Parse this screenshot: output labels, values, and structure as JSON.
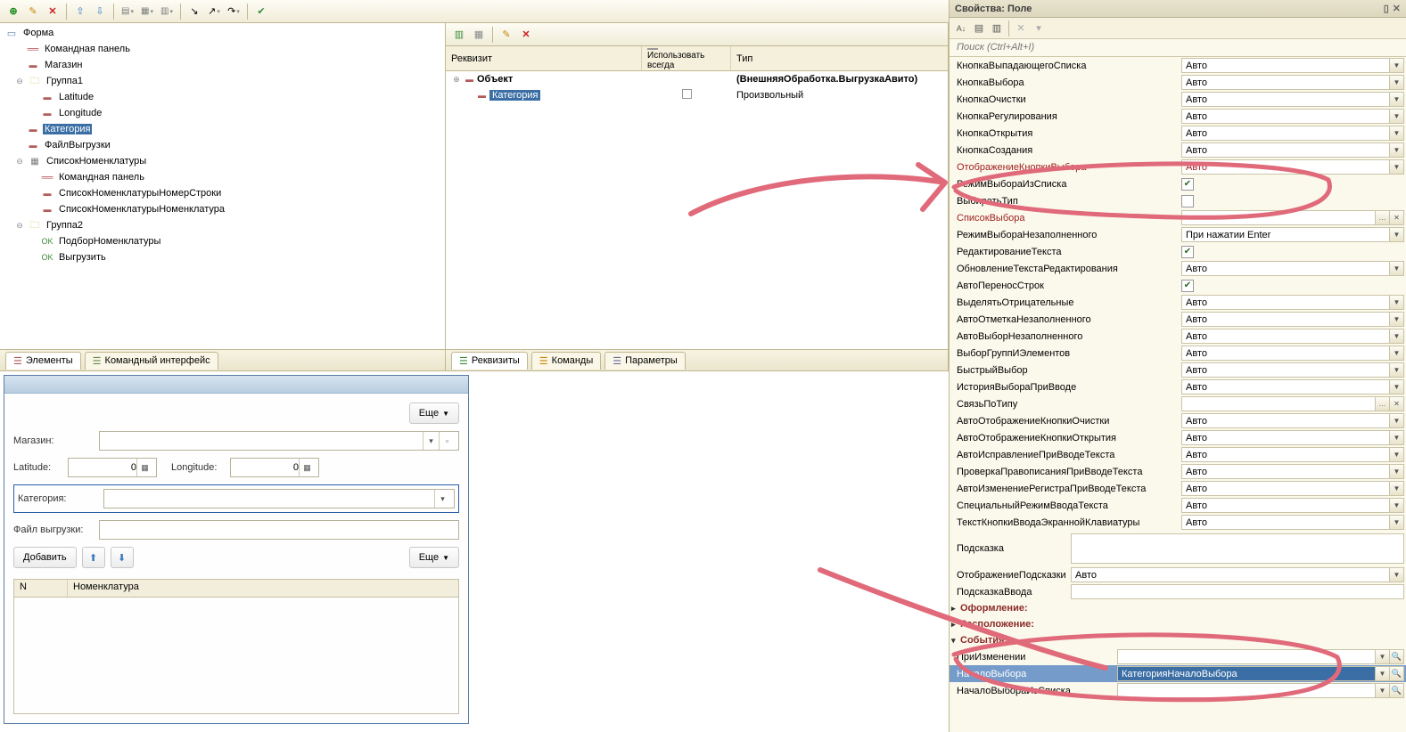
{
  "toolbar": {},
  "tree": {
    "form": "Форма",
    "cmd_panel": "Командная панель",
    "magazin": "Магазин",
    "group1": "Группа1",
    "latitude": "Latitude",
    "longitude": "Longitude",
    "category": "Категория",
    "file_upload": "ФайлВыгрузки",
    "spisok_nom": "СписокНоменклатуры",
    "cmd_panel2": "Командная панель",
    "spisok_row": "СписокНоменклатурыНомерСтроки",
    "spisok_nomk": "СписокНоменклатурыНоменклатура",
    "group2": "Группа2",
    "podbor": "ПодборНоменклатуры",
    "vygruzit": "Выгрузить"
  },
  "tree_tabs": {
    "elements": "Элементы",
    "cmd_iface": "Командный интерфейс"
  },
  "req": {
    "col_name": "Реквизит",
    "col_use": "Использовать всегда",
    "col_type": "Тип",
    "object": "Объект",
    "object_type": "(ВнешняяОбработка.ВыгрузкаАвито)",
    "category": "Категория",
    "category_type": "Произвольный"
  },
  "req_tabs": {
    "rekv": "Реквизиты",
    "cmds": "Команды",
    "params": "Параметры"
  },
  "preview": {
    "more": "Еще",
    "magazin_label": "Магазин:",
    "latitude_label": "Latitude:",
    "latitude_val": "0",
    "longitude_label": "Longitude:",
    "longitude_val": "0",
    "category_label": "Категория:",
    "file_label": "Файл выгрузки:",
    "add": "Добавить",
    "col_n": "N",
    "col_nom": "Номенклатура"
  },
  "props_title": "Свойства: Поле",
  "props_search_placeholder": "Поиск (Ctrl+Alt+I)",
  "props": [
    {
      "label": "КнопкаВыпадающегоСписка",
      "value": "Авто",
      "kind": "dd"
    },
    {
      "label": "КнопкаВыбора",
      "value": "Авто",
      "kind": "dd"
    },
    {
      "label": "КнопкаОчистки",
      "value": "Авто",
      "kind": "dd"
    },
    {
      "label": "КнопкаРегулирования",
      "value": "Авто",
      "kind": "dd"
    },
    {
      "label": "КнопкаОткрытия",
      "value": "Авто",
      "kind": "dd"
    },
    {
      "label": "КнопкаСоздания",
      "value": "Авто",
      "kind": "dd"
    },
    {
      "label": "ОтображениеКнопкиВыбора",
      "value": "Авто",
      "kind": "dd",
      "hot": true
    },
    {
      "label": "РежимВыбораИзСписка",
      "checked": true,
      "kind": "chk"
    },
    {
      "label": "ВыбиратьТип",
      "checked": false,
      "kind": "chk"
    },
    {
      "label": "СписокВыбора",
      "value": "",
      "kind": "dots",
      "hot": true
    },
    {
      "label": "РежимВыбораНезаполненного",
      "value": "При нажатии Enter",
      "kind": "dd"
    },
    {
      "label": "РедактированиеТекста",
      "checked": true,
      "kind": "chk"
    },
    {
      "label": "ОбновлениеТекстаРедактирования",
      "value": "Авто",
      "kind": "dd"
    },
    {
      "label": "АвтоПереносСтрок",
      "checked": true,
      "kind": "chk"
    },
    {
      "label": "ВыделятьОтрицательные",
      "value": "Авто",
      "kind": "dd"
    },
    {
      "label": "АвтоОтметкаНезаполненного",
      "value": "Авто",
      "kind": "dd"
    },
    {
      "label": "АвтоВыборНезаполненного",
      "value": "Авто",
      "kind": "dd"
    },
    {
      "label": "ВыборГруппИЭлементов",
      "value": "Авто",
      "kind": "dd"
    },
    {
      "label": "БыстрыйВыбор",
      "value": "Авто",
      "kind": "dd"
    },
    {
      "label": "ИсторияВыбораПриВводе",
      "value": "Авто",
      "kind": "dd"
    },
    {
      "label": "СвязьПоТипу",
      "value": "",
      "kind": "dots"
    },
    {
      "label": "АвтоОтображениеКнопкиОчистки",
      "value": "Авто",
      "kind": "dd"
    },
    {
      "label": "АвтоОтображениеКнопкиОткрытия",
      "value": "Авто",
      "kind": "dd"
    },
    {
      "label": "АвтоИсправлениеПриВводеТекста",
      "value": "Авто",
      "kind": "dd"
    },
    {
      "label": "ПроверкаПравописанияПриВводеТекста",
      "value": "Авто",
      "kind": "dd"
    },
    {
      "label": "АвтоИзменениеРегистраПриВводеТекста",
      "value": "Авто",
      "kind": "dd"
    },
    {
      "label": "СпециальныйРежимВводаТекста",
      "value": "Авто",
      "kind": "dd"
    },
    {
      "label": "ТекстКнопкиВводаЭкраннойКлавиатуры",
      "value": "Авто",
      "kind": "dd"
    }
  ],
  "props_tail": {
    "hint_label": "Подсказка",
    "hint_display_label": "ОтображениеПодсказки",
    "hint_display_value": "Авто",
    "input_hint_label": "ПодсказкаВвода"
  },
  "sections": {
    "decor": "Оформление:",
    "layout": "Расположение:",
    "events": "События:"
  },
  "events": [
    {
      "label": "ПриИзменении",
      "value": ""
    },
    {
      "label": "НачалоВыбора",
      "value": "КатегорияНачалоВыбора",
      "selected": true
    },
    {
      "label": "НачалоВыбораИзСписка",
      "value": ""
    }
  ]
}
